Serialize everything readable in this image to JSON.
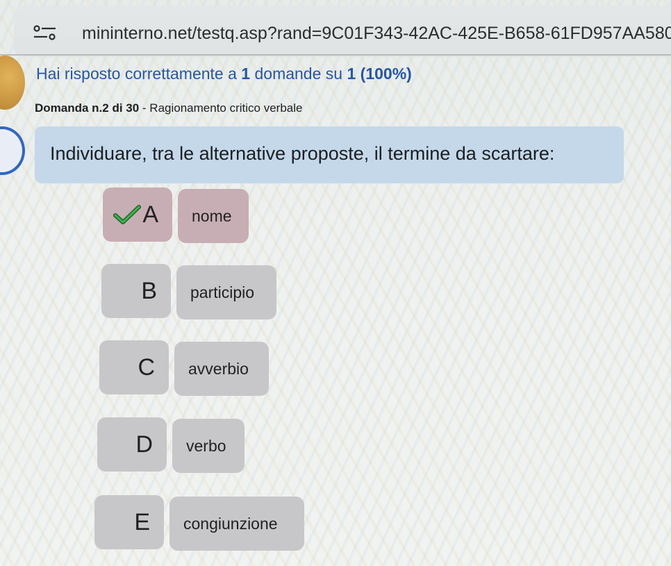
{
  "browser": {
    "url": "mininterno.net/testq.asp?rand=9C01F343-42AC-425E-B658-61FD957AA580",
    "site_icon": "tune-icon"
  },
  "quiz": {
    "score_prefix": "Hai risposto correttamente a ",
    "score_correct": "1",
    "score_mid": " domande su ",
    "score_total": "1",
    "score_percent": "(100%)",
    "question_label": "Domanda n.2 di 30",
    "question_category": " - Ragionamento critico verbale",
    "question_text": "Individuare, tra le alternative proposte, il termine da scartare:",
    "options": [
      {
        "letter": "A",
        "text": "nome",
        "correct": true
      },
      {
        "letter": "B",
        "text": "participio",
        "correct": false
      },
      {
        "letter": "C",
        "text": "avverbio",
        "correct": false
      },
      {
        "letter": "D",
        "text": "verbo",
        "correct": false
      },
      {
        "letter": "E",
        "text": "congiunzione",
        "correct": false
      }
    ]
  },
  "colors": {
    "score_text": "#2556a8",
    "question_bg": "#c4d8ea",
    "option_bg": "#c7c7c9",
    "correct_bg": "#c7aeb4",
    "check": "#2e9a3c"
  }
}
